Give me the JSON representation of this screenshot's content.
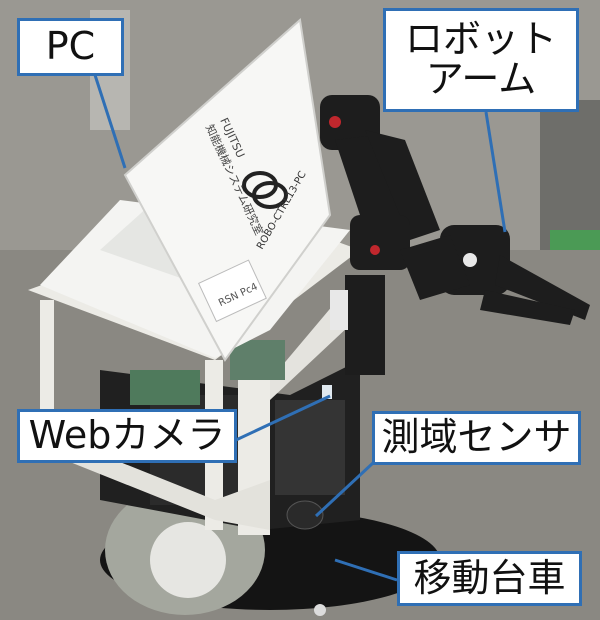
{
  "labels": {
    "pc": "PC",
    "arm": "ロボット\nアーム",
    "camera": "Webカメラ",
    "sensor": "測域センサ",
    "base": "移動台車"
  },
  "laptop_lid_text": {
    "brand": "FUJITSU",
    "lab": "知能機械システム研究室",
    "model": "ROBO-CTRL13-PC",
    "sticker": "RSN Pc4"
  },
  "colors": {
    "callout_border": "#2f6fb5",
    "callout_line": "#2f6fb5",
    "floor": "#8d8b84",
    "frame": "#ecebe6",
    "arm": "#1d1d1d"
  }
}
